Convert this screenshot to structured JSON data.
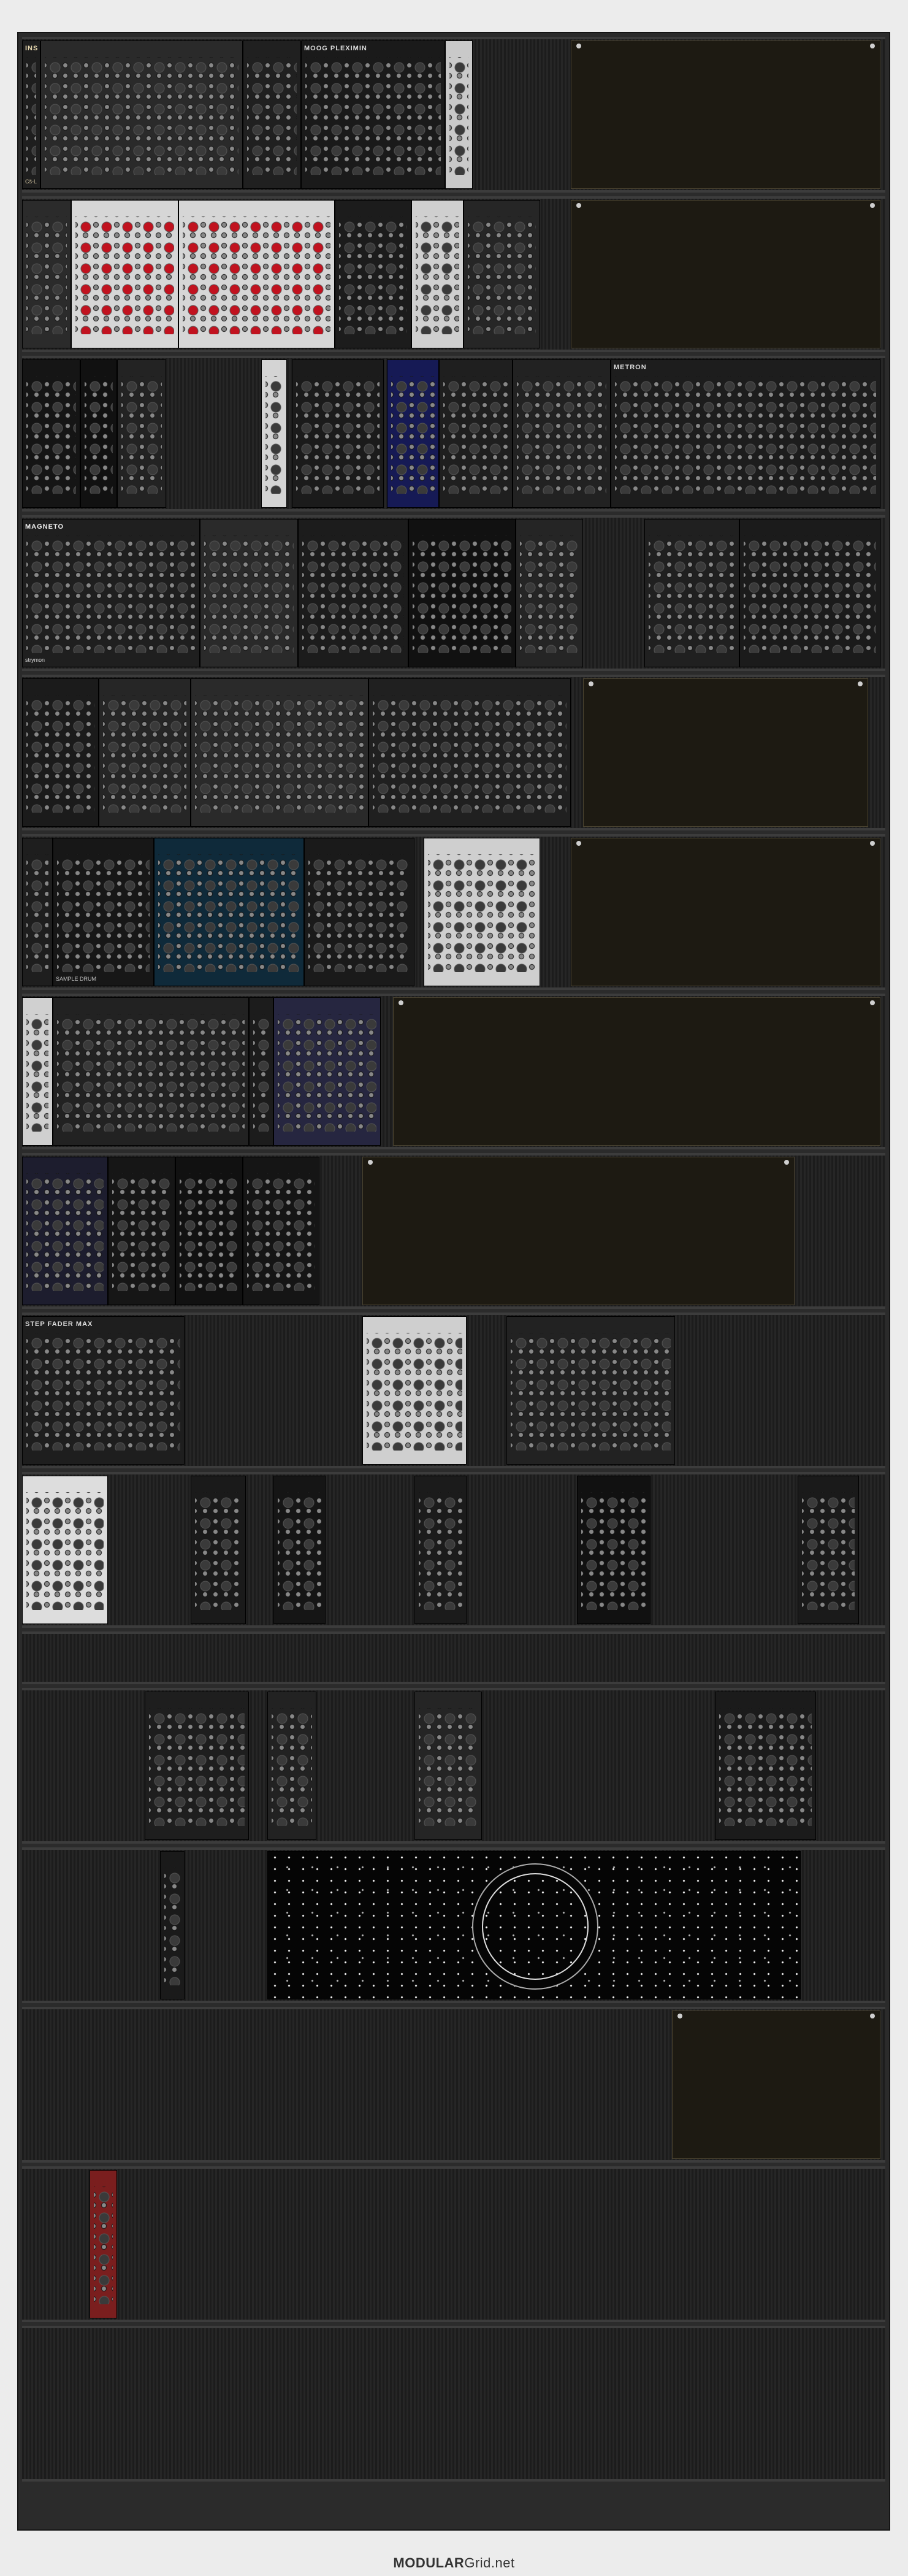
{
  "footer": {
    "brand_bold": "MODULAR",
    "brand_rest": "Grid.net"
  },
  "rows": [
    {
      "modules": [
        {
          "label": "INSTRUŌ",
          "brand": "Cš-L",
          "bg": "#1e1e1e",
          "fg": "#e8d9b0"
        },
        {
          "label": "",
          "brand": "",
          "bg": "#2a2a2a",
          "fg": "#ccc"
        },
        {
          "label": "",
          "brand": "",
          "bg": "#202020",
          "fg": "#ddd"
        },
        {
          "label": "MOOG PLEXIMIN",
          "brand": "",
          "bg": "#1a1a1a",
          "fg": "#ddd"
        },
        {
          "label": "",
          "brand": "",
          "bg": "#c9c9c9",
          "fg": "#333"
        }
      ]
    },
    {
      "modules": [
        {
          "label": "",
          "brand": "",
          "bg": "#2b2b2b",
          "fg": "#ddd"
        },
        {
          "label": "",
          "brand": "",
          "bg": "#d6d6d6",
          "fg": "#b3141a"
        },
        {
          "label": "",
          "brand": "",
          "bg": "#d6d6d6",
          "fg": "#b3141a"
        },
        {
          "label": "",
          "brand": "",
          "bg": "#1c1c1c",
          "fg": "#ddd"
        },
        {
          "label": "",
          "brand": "",
          "bg": "#cfcfcf",
          "fg": "#333"
        },
        {
          "label": "",
          "brand": "",
          "bg": "#262626",
          "fg": "#ddd"
        }
      ]
    },
    {
      "modules": [
        {
          "label": "",
          "brand": "",
          "bg": "#151515",
          "fg": "#ddd"
        },
        {
          "label": "",
          "brand": "",
          "bg": "#111",
          "fg": "#c8a84a"
        },
        {
          "label": "",
          "brand": "",
          "bg": "#232323",
          "fg": "#ddd"
        },
        {
          "label": "",
          "brand": "",
          "bg": "#d4d4d4",
          "fg": "#333"
        },
        {
          "label": "",
          "brand": "",
          "bg": "#1b1b1b",
          "fg": "#ddd"
        },
        {
          "label": "",
          "brand": "",
          "bg": "#161a55",
          "fg": "#ccc"
        },
        {
          "label": "",
          "brand": "",
          "bg": "#1f1f1f",
          "fg": "#ddd"
        },
        {
          "label": "",
          "brand": "",
          "bg": "#222",
          "fg": "#ddd"
        },
        {
          "label": "METRON",
          "brand": "",
          "bg": "#1d1d1d",
          "fg": "#ddd"
        }
      ]
    },
    {
      "modules": [
        {
          "label": "MAGNETO",
          "brand": "strymon",
          "bg": "#1f1f1f",
          "fg": "#eee"
        },
        {
          "label": "",
          "brand": "",
          "bg": "#2a2a2a",
          "fg": "#ddd"
        },
        {
          "label": "",
          "brand": "",
          "bg": "#1c1c1c",
          "fg": "#ddd"
        },
        {
          "label": "",
          "brand": "",
          "bg": "#111",
          "fg": "#ddd"
        },
        {
          "label": "",
          "brand": "",
          "bg": "#252525",
          "fg": "#ddd"
        },
        {
          "label": "",
          "brand": "",
          "bg": "#202020",
          "fg": "#ddd"
        },
        {
          "label": "",
          "brand": "",
          "bg": "#1b1b1b",
          "fg": "#ddd"
        }
      ]
    },
    {
      "modules": [
        {
          "label": "",
          "brand": "",
          "bg": "#1b1b1b",
          "fg": "#ddd"
        },
        {
          "label": "",
          "brand": "",
          "bg": "#262626",
          "fg": "#ddd"
        },
        {
          "label": "",
          "brand": "",
          "bg": "#2a2a2a",
          "fg": "#c8a84a"
        },
        {
          "label": "",
          "brand": "",
          "bg": "#202020",
          "fg": "#c8a84a"
        }
      ]
    },
    {
      "modules": [
        {
          "label": "",
          "brand": "",
          "bg": "#1e1e1e",
          "fg": "#ddd"
        },
        {
          "label": "",
          "brand": "SAMPLE DRUM",
          "bg": "#171717",
          "fg": "#ddd"
        },
        {
          "label": "",
          "brand": "",
          "bg": "#0f2a3a",
          "fg": "#7fd0ff"
        },
        {
          "label": "",
          "brand": "",
          "bg": "#1a1a1a",
          "fg": "#ddd"
        },
        {
          "label": "",
          "brand": "",
          "bg": "#cfcfcf",
          "fg": "#333"
        }
      ]
    },
    {
      "modules": [
        {
          "label": "",
          "brand": "",
          "bg": "#d0d0d0",
          "fg": "#333"
        },
        {
          "label": "",
          "brand": "",
          "bg": "#222",
          "fg": "#ddd"
        },
        {
          "label": "",
          "brand": "",
          "bg": "#1c1c1c",
          "fg": "#ddd"
        },
        {
          "label": "",
          "brand": "",
          "bg": "#262640",
          "fg": "#ddd"
        }
      ]
    },
    {
      "modules": [
        {
          "label": "",
          "brand": "",
          "bg": "#1d1d2e",
          "fg": "#ddd"
        },
        {
          "label": "",
          "brand": "",
          "bg": "#161616",
          "fg": "#ddd"
        },
        {
          "label": "",
          "brand": "",
          "bg": "#111",
          "fg": "#ddd"
        },
        {
          "label": "",
          "brand": "",
          "bg": "#151515",
          "fg": "#ddd"
        }
      ]
    },
    {
      "modules": [
        {
          "label": "STEP FADER MAX",
          "brand": "",
          "bg": "#1e1e1e",
          "fg": "#ddd"
        },
        {
          "label": "",
          "brand": "",
          "bg": "#cfcfcf",
          "fg": "#333"
        },
        {
          "label": "",
          "brand": "",
          "bg": "#222",
          "fg": "#ddd"
        }
      ]
    },
    {
      "modules": [
        {
          "label": "",
          "brand": "",
          "bg": "#ddd",
          "fg": "#333"
        },
        {
          "label": "",
          "brand": "",
          "bg": "#1a1a1a",
          "fg": "#ddd"
        },
        {
          "label": "",
          "brand": "",
          "bg": "#151515",
          "fg": "#ddd"
        },
        {
          "label": "",
          "brand": "",
          "bg": "#1b1b1b",
          "fg": "#ddd"
        },
        {
          "label": "",
          "brand": "",
          "bg": "#111",
          "fg": "#ddd"
        },
        {
          "label": "",
          "brand": "",
          "bg": "#1a1a1a",
          "fg": "#ddd"
        }
      ]
    },
    {
      "modules": []
    },
    {
      "modules": [
        {
          "label": "",
          "brand": "",
          "bg": "#1e1e1e",
          "fg": "#ddd"
        },
        {
          "label": "",
          "brand": "",
          "bg": "#222",
          "fg": "#ddd"
        },
        {
          "label": "",
          "brand": "",
          "bg": "#252525",
          "fg": "#ddd"
        },
        {
          "label": "",
          "brand": "",
          "bg": "#1b1b1b",
          "fg": "#ddd"
        },
        {
          "label": "",
          "brand": "",
          "bg": "#9a9a9a",
          "fg": "#222"
        }
      ]
    },
    {
      "modules": [
        {
          "label": "",
          "brand": "",
          "bg": "#1a1a1a",
          "fg": "#ddd"
        }
      ]
    },
    {
      "modules": []
    },
    {
      "modules": [
        {
          "label": "",
          "brand": "",
          "bg": "#7a1e1e",
          "fg": "#eee"
        }
      ]
    },
    {
      "modules": []
    }
  ],
  "colors": {
    "accent_red": "#c1121f",
    "panel_gold": "#c8a84a",
    "blank_panel": "#1d1a12"
  }
}
